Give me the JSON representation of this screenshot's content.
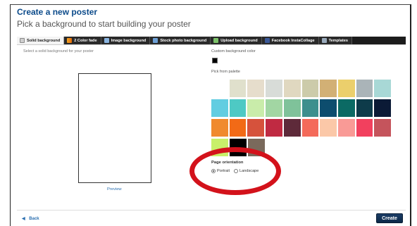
{
  "header": {
    "title": "Create a new poster",
    "subtitle": "Pick a background to start building your poster"
  },
  "tabs": [
    {
      "label": "Solid background",
      "icon": "solid-icon",
      "active": true
    },
    {
      "label": "2 Color fade",
      "icon": "fade-icon",
      "active": false
    },
    {
      "label": "Image background",
      "icon": "image-icon",
      "active": false
    },
    {
      "label": "Stock photo background",
      "icon": "stock-photo-icon",
      "active": false
    },
    {
      "label": "Upload background",
      "icon": "upload-icon",
      "active": false
    },
    {
      "label": "Facebook InstaCollage",
      "icon": "facebook-icon",
      "active": false
    },
    {
      "label": "Templates",
      "icon": "templates-icon",
      "active": false
    }
  ],
  "left": {
    "hint": "Select a solid background for your poster",
    "preview_label": "Preview"
  },
  "right": {
    "custom_label": "Custom background color",
    "custom_color": "#000000",
    "palette_label": "Pick from palette",
    "palette_rows": [
      [
        "#ffffff",
        "#e0e0cc",
        "#e6ddcc",
        "#d8dcd8",
        "#e0d8c0",
        "#cccbaa",
        "#d2b075",
        "#ebcf6c",
        "#aab4b8",
        "#a8d8d6"
      ],
      [
        "#62cde1",
        "#4ec9c4",
        "#c9ecaa",
        "#a2d6a3",
        "#7fc29a",
        "#3d8f8d",
        "#0d4d6e",
        "#0b6a64",
        "#0e3b4a",
        "#0b1a36"
      ],
      [
        "#f08a2e",
        "#f26a16",
        "#d6523c",
        "#c02a42",
        "#5e2a3a",
        "#f46a5a",
        "#fbc8a8",
        "#f99a96",
        "#f2405e",
        "#c5545c"
      ],
      [
        "#c8f06a",
        "#000000",
        "#7a6a5c"
      ]
    ],
    "orientation_label": "Page orientation",
    "orientation_options": [
      {
        "label": "Portrait",
        "selected": true
      },
      {
        "label": "Landscape",
        "selected": false
      }
    ]
  },
  "footer": {
    "back_label": "Back",
    "create_label": "Create"
  },
  "annotation_color": "#d3121b"
}
